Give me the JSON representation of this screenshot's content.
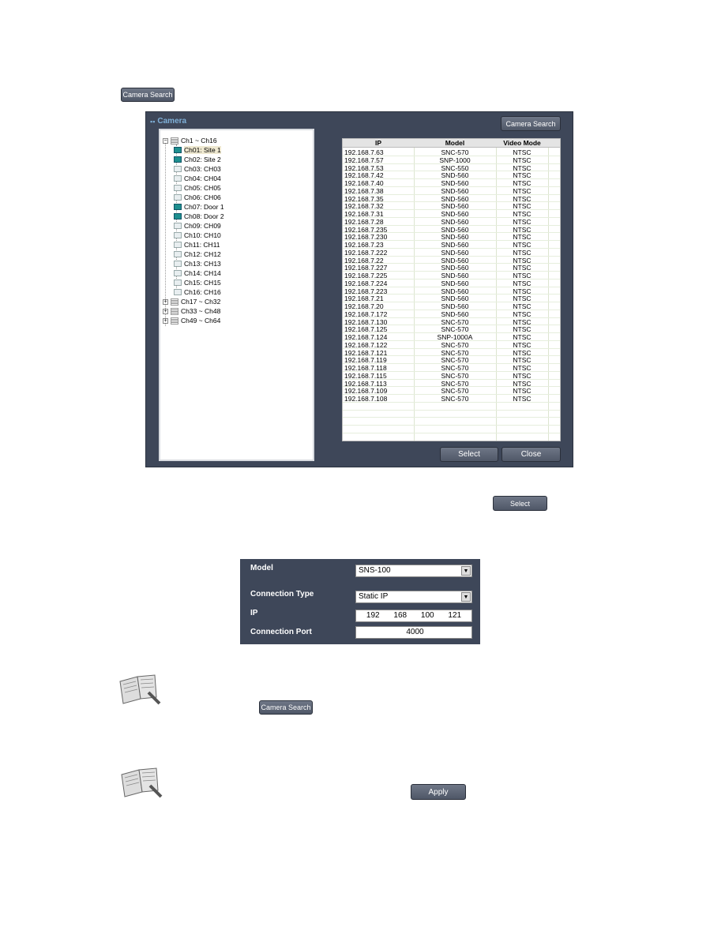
{
  "top_button": "Camera Search",
  "dialog": {
    "title": "Camera",
    "search_button": "Camera Search",
    "tree": {
      "group1": "Ch1 ~ Ch16",
      "channels": [
        {
          "label": "Ch01: Site 1",
          "active": true,
          "selected": true
        },
        {
          "label": "Ch02: Site 2",
          "active": true
        },
        {
          "label": "Ch03: CH03",
          "active": false
        },
        {
          "label": "Ch04: CH04",
          "active": false
        },
        {
          "label": "Ch05: CH05",
          "active": false
        },
        {
          "label": "Ch06: CH06",
          "active": false
        },
        {
          "label": "Ch07: Door 1",
          "active": true
        },
        {
          "label": "Ch08: Door 2",
          "active": true
        },
        {
          "label": "Ch09: CH09",
          "active": false
        },
        {
          "label": "Ch10: CH10",
          "active": false
        },
        {
          "label": "Ch11: CH11",
          "active": false
        },
        {
          "label": "Ch12: CH12",
          "active": false
        },
        {
          "label": "Ch13: CH13",
          "active": false
        },
        {
          "label": "Ch14: CH14",
          "active": false
        },
        {
          "label": "Ch15: CH15",
          "active": false
        },
        {
          "label": "Ch16: CH16",
          "active": false
        }
      ],
      "collapsed_groups": [
        "Ch17 ~ Ch32",
        "Ch33 ~ Ch48",
        "Ch49 ~ Ch64"
      ]
    },
    "table": {
      "headers": [
        "IP",
        "Model",
        "Video Mode"
      ],
      "rows": [
        [
          "192.168.7.63",
          "SNC-570",
          "NTSC"
        ],
        [
          "192.168.7.57",
          "SNP-1000",
          "NTSC"
        ],
        [
          "192.168.7.53",
          "SNC-550",
          "NTSC"
        ],
        [
          "192.168.7.42",
          "SND-560",
          "NTSC"
        ],
        [
          "192.168.7.40",
          "SND-560",
          "NTSC"
        ],
        [
          "192.168.7.38",
          "SND-560",
          "NTSC"
        ],
        [
          "192.168.7.35",
          "SND-560",
          "NTSC"
        ],
        [
          "192.168.7.32",
          "SND-560",
          "NTSC"
        ],
        [
          "192.168.7.31",
          "SND-560",
          "NTSC"
        ],
        [
          "192.168.7.28",
          "SND-560",
          "NTSC"
        ],
        [
          "192.168.7.235",
          "SND-560",
          "NTSC"
        ],
        [
          "192.168.7.230",
          "SND-560",
          "NTSC"
        ],
        [
          "192.168.7.23",
          "SND-560",
          "NTSC"
        ],
        [
          "192.168.7.222",
          "SND-560",
          "NTSC"
        ],
        [
          "192.168.7.22",
          "SND-560",
          "NTSC"
        ],
        [
          "192.168.7.227",
          "SND-560",
          "NTSC"
        ],
        [
          "192.168.7.225",
          "SND-560",
          "NTSC"
        ],
        [
          "192.168.7.224",
          "SND-560",
          "NTSC"
        ],
        [
          "192.168.7.223",
          "SND-560",
          "NTSC"
        ],
        [
          "192.168.7.21",
          "SND-560",
          "NTSC"
        ],
        [
          "192.168.7.20",
          "SND-560",
          "NTSC"
        ],
        [
          "192.168.7.172",
          "SND-560",
          "NTSC"
        ],
        [
          "192.168.7.130",
          "SNC-570",
          "NTSC"
        ],
        [
          "192.168.7.125",
          "SNC-570",
          "NTSC"
        ],
        [
          "192.168.7.124",
          "SNP-1000A",
          "NTSC"
        ],
        [
          "192.168.7.122",
          "SNC-570",
          "NTSC"
        ],
        [
          "192.168.7.121",
          "SNC-570",
          "NTSC"
        ],
        [
          "192.168.7.119",
          "SNC-570",
          "NTSC"
        ],
        [
          "192.168.7.118",
          "SNC-570",
          "NTSC"
        ],
        [
          "192.168.7.115",
          "SNC-570",
          "NTSC"
        ],
        [
          "192.168.7.113",
          "SNC-570",
          "NTSC"
        ],
        [
          "192.168.7.109",
          "SNC-570",
          "NTSC"
        ],
        [
          "192.168.7.108",
          "SNC-570",
          "NTSC"
        ]
      ]
    },
    "select_button": "Select",
    "close_button": "Close"
  },
  "inline_select_button": "Select",
  "settings": {
    "model_label": "Model",
    "model_value": "SNS-100",
    "conn_type_label": "Connection Type",
    "conn_type_value": "Static IP",
    "ip_label": "IP",
    "ip": [
      "192",
      "168",
      "100",
      "121"
    ],
    "port_label": "Connection Port",
    "port_value": "4000"
  },
  "note1_button": "Camera Search",
  "note2_button": "Apply"
}
